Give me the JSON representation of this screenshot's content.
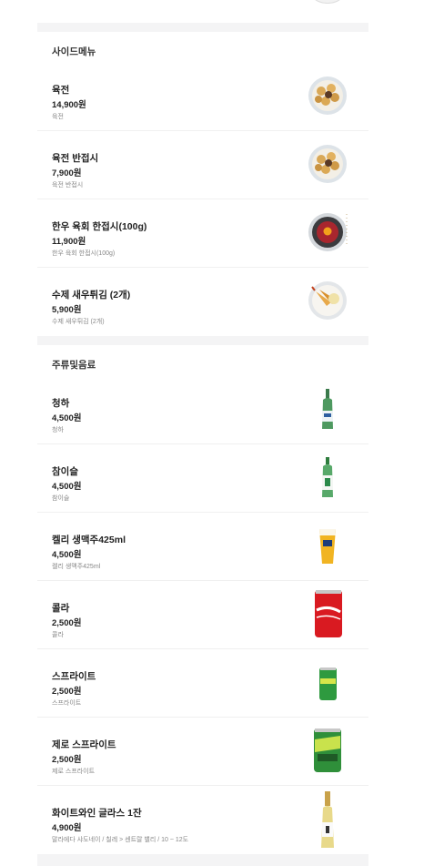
{
  "sections": [
    {
      "title": "사이드메뉴",
      "items": [
        {
          "name": "육전",
          "price": "14,900원",
          "desc": "육전",
          "image": "yukjeon-plate"
        },
        {
          "name": "육전 반접시",
          "price": "7,900원",
          "desc": "육전 반접시",
          "image": "yukjeon-plate"
        },
        {
          "name": "한우 육회 한접시(100g)",
          "price": "11,900원",
          "desc": "한우 육회 한접시(100g)",
          "image": "yukhoe-plate"
        },
        {
          "name": "수제 새우튀김 (2개)",
          "price": "5,900원",
          "desc": "수제 새우튀김 (2개)",
          "image": "shrimp-tempura-plate"
        }
      ]
    },
    {
      "title": "주류및음료",
      "items": [
        {
          "name": "청하",
          "price": "4,500원",
          "desc": "청하",
          "image": "cheongha-bottle"
        },
        {
          "name": "참이슬",
          "price": "4,500원",
          "desc": "참이슬",
          "image": "chamisul-bottle"
        },
        {
          "name": "켈리 생맥주425ml",
          "price": "4,500원",
          "desc": "켈리 생맥주425ml",
          "image": "beer-glass"
        },
        {
          "name": "콜라",
          "price": "2,500원",
          "desc": "콜라",
          "image": "cola-can"
        },
        {
          "name": "스프라이트",
          "price": "2,500원",
          "desc": "스프라이트",
          "image": "sprite-can"
        },
        {
          "name": "제로 스프라이트",
          "price": "2,500원",
          "desc": "제로 스프라이트",
          "image": "sprite-zero-can"
        },
        {
          "name": "화이트와인 글라스 1잔",
          "price": "4,900원",
          "desc": "말라에다 샤도네이 / 칠레 > 센트랄 밸리 / 10 ~ 12도",
          "image": "white-wine-bottle"
        }
      ]
    }
  ],
  "colors": {
    "page_bg": "#f4f4f5",
    "card_bg": "#ffffff",
    "text": "#222222",
    "desc": "#888888"
  }
}
